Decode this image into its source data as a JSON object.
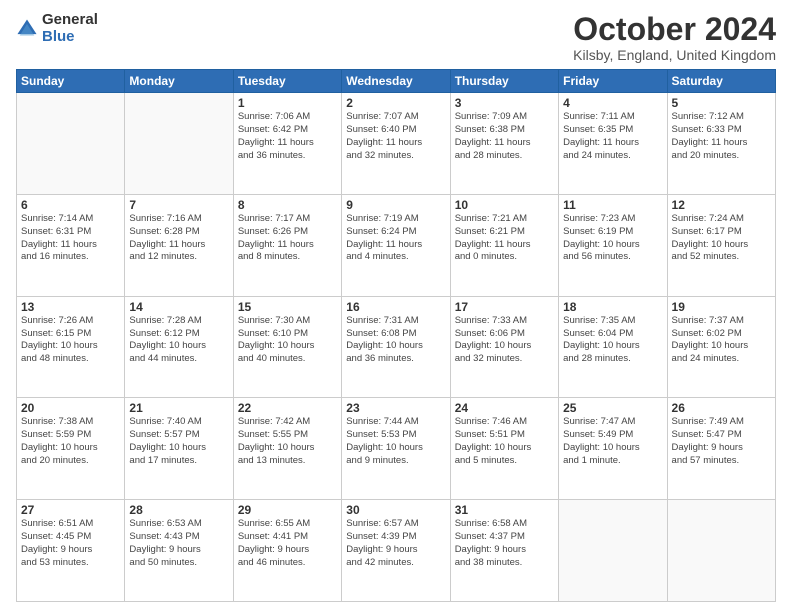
{
  "header": {
    "logo_general": "General",
    "logo_blue": "Blue",
    "title": "October 2024",
    "subtitle": "Kilsby, England, United Kingdom"
  },
  "weekdays": [
    "Sunday",
    "Monday",
    "Tuesday",
    "Wednesday",
    "Thursday",
    "Friday",
    "Saturday"
  ],
  "weeks": [
    [
      {
        "day": "",
        "info": ""
      },
      {
        "day": "",
        "info": ""
      },
      {
        "day": "1",
        "info": "Sunrise: 7:06 AM\nSunset: 6:42 PM\nDaylight: 11 hours\nand 36 minutes."
      },
      {
        "day": "2",
        "info": "Sunrise: 7:07 AM\nSunset: 6:40 PM\nDaylight: 11 hours\nand 32 minutes."
      },
      {
        "day": "3",
        "info": "Sunrise: 7:09 AM\nSunset: 6:38 PM\nDaylight: 11 hours\nand 28 minutes."
      },
      {
        "day": "4",
        "info": "Sunrise: 7:11 AM\nSunset: 6:35 PM\nDaylight: 11 hours\nand 24 minutes."
      },
      {
        "day": "5",
        "info": "Sunrise: 7:12 AM\nSunset: 6:33 PM\nDaylight: 11 hours\nand 20 minutes."
      }
    ],
    [
      {
        "day": "6",
        "info": "Sunrise: 7:14 AM\nSunset: 6:31 PM\nDaylight: 11 hours\nand 16 minutes."
      },
      {
        "day": "7",
        "info": "Sunrise: 7:16 AM\nSunset: 6:28 PM\nDaylight: 11 hours\nand 12 minutes."
      },
      {
        "day": "8",
        "info": "Sunrise: 7:17 AM\nSunset: 6:26 PM\nDaylight: 11 hours\nand 8 minutes."
      },
      {
        "day": "9",
        "info": "Sunrise: 7:19 AM\nSunset: 6:24 PM\nDaylight: 11 hours\nand 4 minutes."
      },
      {
        "day": "10",
        "info": "Sunrise: 7:21 AM\nSunset: 6:21 PM\nDaylight: 11 hours\nand 0 minutes."
      },
      {
        "day": "11",
        "info": "Sunrise: 7:23 AM\nSunset: 6:19 PM\nDaylight: 10 hours\nand 56 minutes."
      },
      {
        "day": "12",
        "info": "Sunrise: 7:24 AM\nSunset: 6:17 PM\nDaylight: 10 hours\nand 52 minutes."
      }
    ],
    [
      {
        "day": "13",
        "info": "Sunrise: 7:26 AM\nSunset: 6:15 PM\nDaylight: 10 hours\nand 48 minutes."
      },
      {
        "day": "14",
        "info": "Sunrise: 7:28 AM\nSunset: 6:12 PM\nDaylight: 10 hours\nand 44 minutes."
      },
      {
        "day": "15",
        "info": "Sunrise: 7:30 AM\nSunset: 6:10 PM\nDaylight: 10 hours\nand 40 minutes."
      },
      {
        "day": "16",
        "info": "Sunrise: 7:31 AM\nSunset: 6:08 PM\nDaylight: 10 hours\nand 36 minutes."
      },
      {
        "day": "17",
        "info": "Sunrise: 7:33 AM\nSunset: 6:06 PM\nDaylight: 10 hours\nand 32 minutes."
      },
      {
        "day": "18",
        "info": "Sunrise: 7:35 AM\nSunset: 6:04 PM\nDaylight: 10 hours\nand 28 minutes."
      },
      {
        "day": "19",
        "info": "Sunrise: 7:37 AM\nSunset: 6:02 PM\nDaylight: 10 hours\nand 24 minutes."
      }
    ],
    [
      {
        "day": "20",
        "info": "Sunrise: 7:38 AM\nSunset: 5:59 PM\nDaylight: 10 hours\nand 20 minutes."
      },
      {
        "day": "21",
        "info": "Sunrise: 7:40 AM\nSunset: 5:57 PM\nDaylight: 10 hours\nand 17 minutes."
      },
      {
        "day": "22",
        "info": "Sunrise: 7:42 AM\nSunset: 5:55 PM\nDaylight: 10 hours\nand 13 minutes."
      },
      {
        "day": "23",
        "info": "Sunrise: 7:44 AM\nSunset: 5:53 PM\nDaylight: 10 hours\nand 9 minutes."
      },
      {
        "day": "24",
        "info": "Sunrise: 7:46 AM\nSunset: 5:51 PM\nDaylight: 10 hours\nand 5 minutes."
      },
      {
        "day": "25",
        "info": "Sunrise: 7:47 AM\nSunset: 5:49 PM\nDaylight: 10 hours\nand 1 minute."
      },
      {
        "day": "26",
        "info": "Sunrise: 7:49 AM\nSunset: 5:47 PM\nDaylight: 9 hours\nand 57 minutes."
      }
    ],
    [
      {
        "day": "27",
        "info": "Sunrise: 6:51 AM\nSunset: 4:45 PM\nDaylight: 9 hours\nand 53 minutes."
      },
      {
        "day": "28",
        "info": "Sunrise: 6:53 AM\nSunset: 4:43 PM\nDaylight: 9 hours\nand 50 minutes."
      },
      {
        "day": "29",
        "info": "Sunrise: 6:55 AM\nSunset: 4:41 PM\nDaylight: 9 hours\nand 46 minutes."
      },
      {
        "day": "30",
        "info": "Sunrise: 6:57 AM\nSunset: 4:39 PM\nDaylight: 9 hours\nand 42 minutes."
      },
      {
        "day": "31",
        "info": "Sunrise: 6:58 AM\nSunset: 4:37 PM\nDaylight: 9 hours\nand 38 minutes."
      },
      {
        "day": "",
        "info": ""
      },
      {
        "day": "",
        "info": ""
      }
    ]
  ]
}
